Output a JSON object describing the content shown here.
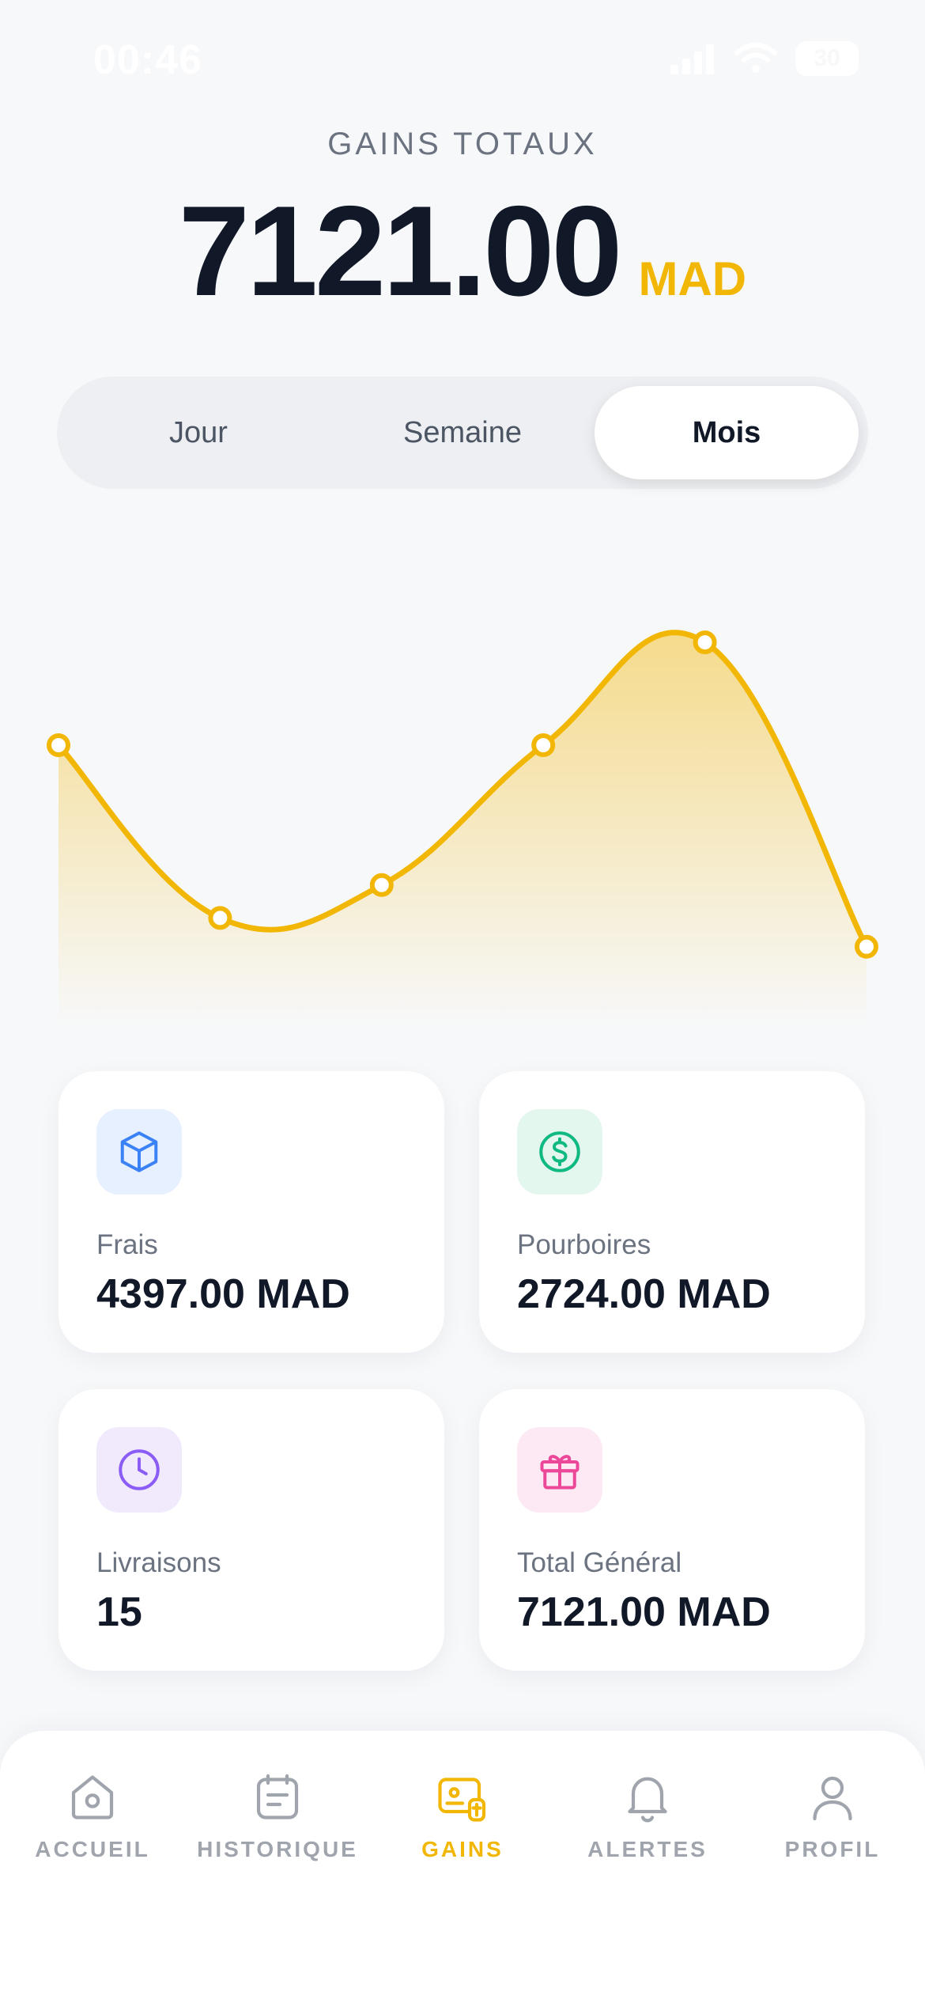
{
  "status_bar": {
    "time": "00:46",
    "battery": "30"
  },
  "header": {
    "label": "GAINS TOTAUX",
    "amount": "7121.00",
    "currency": "MAD"
  },
  "segments": [
    {
      "label": "Jour",
      "active": false
    },
    {
      "label": "Semaine",
      "active": false
    },
    {
      "label": "Mois",
      "active": true
    }
  ],
  "chart_data": {
    "type": "area",
    "x": [
      0,
      1,
      2,
      3,
      4,
      5
    ],
    "values": [
      65,
      23,
      31,
      65,
      90,
      16
    ],
    "ylim": [
      0,
      100
    ],
    "color": "#F2B705",
    "grid": false,
    "title": "",
    "xlabel": "",
    "ylabel": ""
  },
  "stats": [
    {
      "label": "Frais",
      "value": "4397.00 MAD",
      "icon": "package-icon",
      "icon_color": "#3B82F6",
      "icon_bg": "#E6F0FF"
    },
    {
      "label": "Pourboires",
      "value": "2724.00 MAD",
      "icon": "dollar-coin-icon",
      "icon_color": "#10B981",
      "icon_bg": "#E4F7EF"
    },
    {
      "label": "Livraisons",
      "value": "15",
      "icon": "clock-icon",
      "icon_color": "#8B5CF6",
      "icon_bg": "#F1EAFD"
    },
    {
      "label": "Total Général",
      "value": "7121.00 MAD",
      "icon": "gift-icon",
      "icon_color": "#EC4899",
      "icon_bg": "#FCE9F3"
    }
  ],
  "nav": [
    {
      "label": "ACCUEIL",
      "icon": "home-icon",
      "active": false
    },
    {
      "label": "HISTORIQUE",
      "icon": "history-icon",
      "active": false
    },
    {
      "label": "GAINS",
      "icon": "wallet-icon",
      "active": true
    },
    {
      "label": "ALERTES",
      "icon": "bell-icon",
      "active": false
    },
    {
      "label": "PROFIL",
      "icon": "user-icon",
      "active": false
    }
  ],
  "colors": {
    "accent": "#F2B705",
    "text": "#111827",
    "muted": "#6B7280",
    "nav_inactive": "#A0A4AD"
  }
}
